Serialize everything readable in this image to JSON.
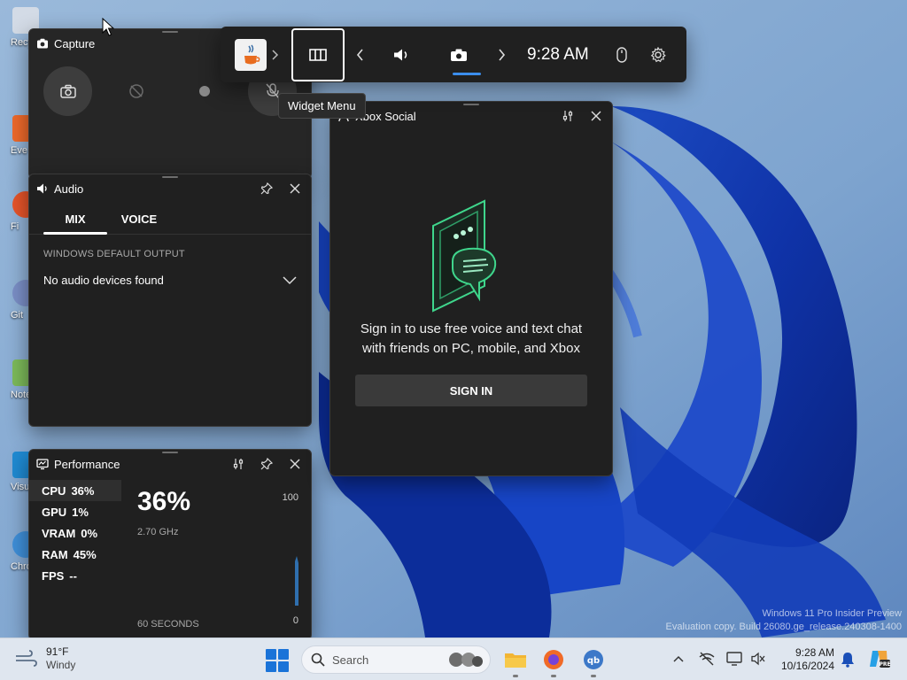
{
  "game_bar": {
    "time": "9:28 AM",
    "tooltip": "Widget Menu"
  },
  "capture": {
    "title": "Capture"
  },
  "audio": {
    "title": "Audio",
    "tabs": [
      {
        "label": "MIX",
        "active": true
      },
      {
        "label": "VOICE",
        "active": false
      }
    ],
    "section_label": "WINDOWS DEFAULT OUTPUT",
    "dropdown_value": "No audio devices found"
  },
  "performance": {
    "title": "Performance",
    "metrics": [
      {
        "name": "CPU",
        "value": "36%",
        "active": true
      },
      {
        "name": "GPU",
        "value": "1%",
        "active": false
      },
      {
        "name": "VRAM",
        "value": "0%",
        "active": false
      },
      {
        "name": "RAM",
        "value": "45%",
        "active": false
      },
      {
        "name": "FPS",
        "value": "--",
        "active": false
      }
    ],
    "big_value": "36%",
    "frequency": "2.70 GHz",
    "graph_max": "100",
    "graph_min": "0",
    "time_window": "60 SECONDS"
  },
  "social": {
    "title": "Xbox Social",
    "message_line1": "Sign in to use free voice and text chat",
    "message_line2": "with friends on PC, mobile, and Xbox",
    "sign_in_label": "SIGN IN"
  },
  "desktop": {
    "icons": [
      "Recy",
      "Eve",
      "Fi",
      "Git",
      "Note",
      "Visua",
      "Chro"
    ],
    "watermark_line1": "Windows 11 Pro Insider Preview",
    "watermark_line2": "Evaluation copy. Build 26080.ge_release.240308-1400"
  },
  "taskbar": {
    "temperature": "91°F",
    "condition": "Windy",
    "search_placeholder": "Search",
    "clock_time": "9:28 AM",
    "clock_date": "10/16/2024"
  },
  "colors": {
    "panel_bg": "#202020",
    "accent_blue": "#3b8eed",
    "xbox_green": "#3fd68c",
    "taskbar_bg": "#dfe6ef"
  }
}
